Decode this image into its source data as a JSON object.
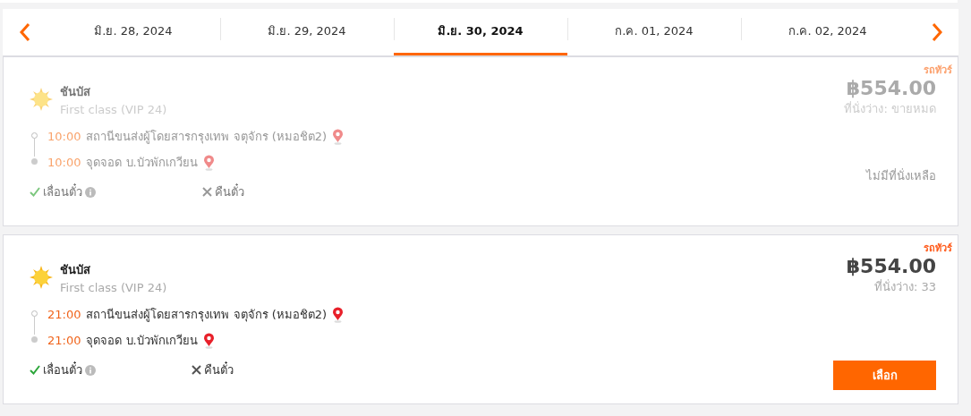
{
  "date_bar": {
    "dates": [
      {
        "label": "มิ.ย. 28, 2024",
        "selected": false
      },
      {
        "label": "มิ.ย. 29, 2024",
        "selected": false
      },
      {
        "label": "มิ.ย. 30, 2024",
        "selected": true
      },
      {
        "label": "ก.ค. 01, 2024",
        "selected": false
      },
      {
        "label": "ก.ค. 02, 2024",
        "selected": false
      }
    ]
  },
  "trips": [
    {
      "disabled": true,
      "tag": "รถทัวร์",
      "operator": "ชันบัส",
      "class": "First class (VIP 24)",
      "price": "฿554.00",
      "seats": "ที่นั่งว่าง: ขายหมด",
      "stops": [
        {
          "time": "10:00",
          "place": "สถานีขนส่งผู้โดยสารกรุงเทพ จตุจักร (หมอชิต2)"
        },
        {
          "time": "10:00",
          "place": "จุดจอด บ.บัวพักเกวียน"
        }
      ],
      "features": [
        {
          "label": "เลื่อนตั๋ว",
          "allowed": true,
          "info": true
        },
        {
          "label": "คืนตั๋ว",
          "allowed": false,
          "info": false
        }
      ],
      "action": {
        "kind": "note",
        "text": "ไม่มีที่นั่งเหลือ"
      }
    },
    {
      "disabled": false,
      "tag": "รถทัวร์",
      "operator": "ชันบัส",
      "class": "First class (VIP 24)",
      "price": "฿554.00",
      "seats": "ที่นั่งว่าง: 33",
      "stops": [
        {
          "time": "21:00",
          "place": "สถานีขนส่งผู้โดยสารกรุงเทพ จตุจักร (หมอชิต2)"
        },
        {
          "time": "21:00",
          "place": "จุดจอด บ.บัวพักเกวียน"
        }
      ],
      "features": [
        {
          "label": "เลื่อนตั๋ว",
          "allowed": true,
          "info": true
        },
        {
          "label": "คืนตั๋ว",
          "allowed": false,
          "info": false
        }
      ],
      "action": {
        "kind": "button",
        "text": "เลือก"
      }
    }
  ]
}
